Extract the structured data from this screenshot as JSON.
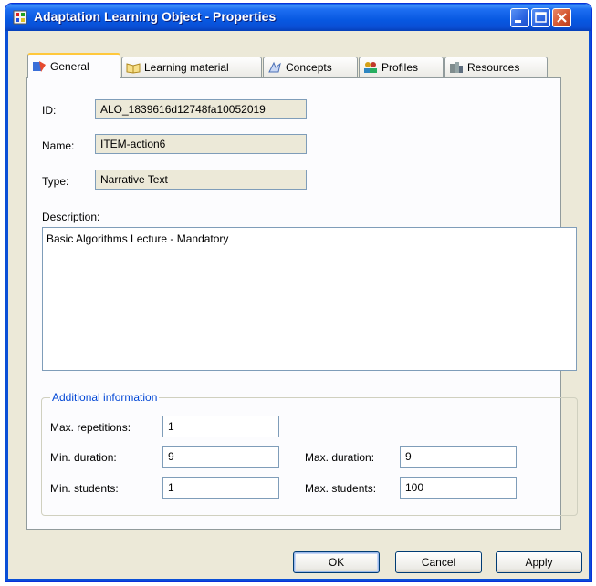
{
  "window": {
    "title": "Adaptation Learning Object - Properties"
  },
  "tabs": [
    {
      "label": "General",
      "icon": "general-icon"
    },
    {
      "label": "Learning material",
      "icon": "book-icon"
    },
    {
      "label": "Concepts",
      "icon": "concepts-icon"
    },
    {
      "label": "Profiles",
      "icon": "users-icon"
    },
    {
      "label": "Resources",
      "icon": "resources-icon"
    }
  ],
  "general": {
    "id_label": "ID:",
    "id_value": "ALO_1839616d12748fa10052019",
    "name_label": "Name:",
    "name_value": "ITEM-action6",
    "type_label": "Type:",
    "type_value": "Narrative Text",
    "description_label": "Description:",
    "description_value": "Basic Algorithms Lecture - Mandatory"
  },
  "additional": {
    "title": "Additional information",
    "max_repetitions_label": "Max. repetitions:",
    "max_repetitions_value": "1",
    "min_duration_label": "Min. duration:",
    "min_duration_value": "9",
    "max_duration_label": "Max. duration:",
    "max_duration_value": "9",
    "min_students_label": "Min. students:",
    "min_students_value": "1",
    "max_students_label": "Max. students:",
    "max_students_value": "100"
  },
  "buttons": {
    "ok": "OK",
    "cancel": "Cancel",
    "apply": "Apply"
  },
  "colors": {
    "titlebar": "#0a4fd6",
    "dialog_bg": "#ece9d8",
    "group_title": "#0046d5",
    "active_tab_accent": "#ffc83c"
  }
}
